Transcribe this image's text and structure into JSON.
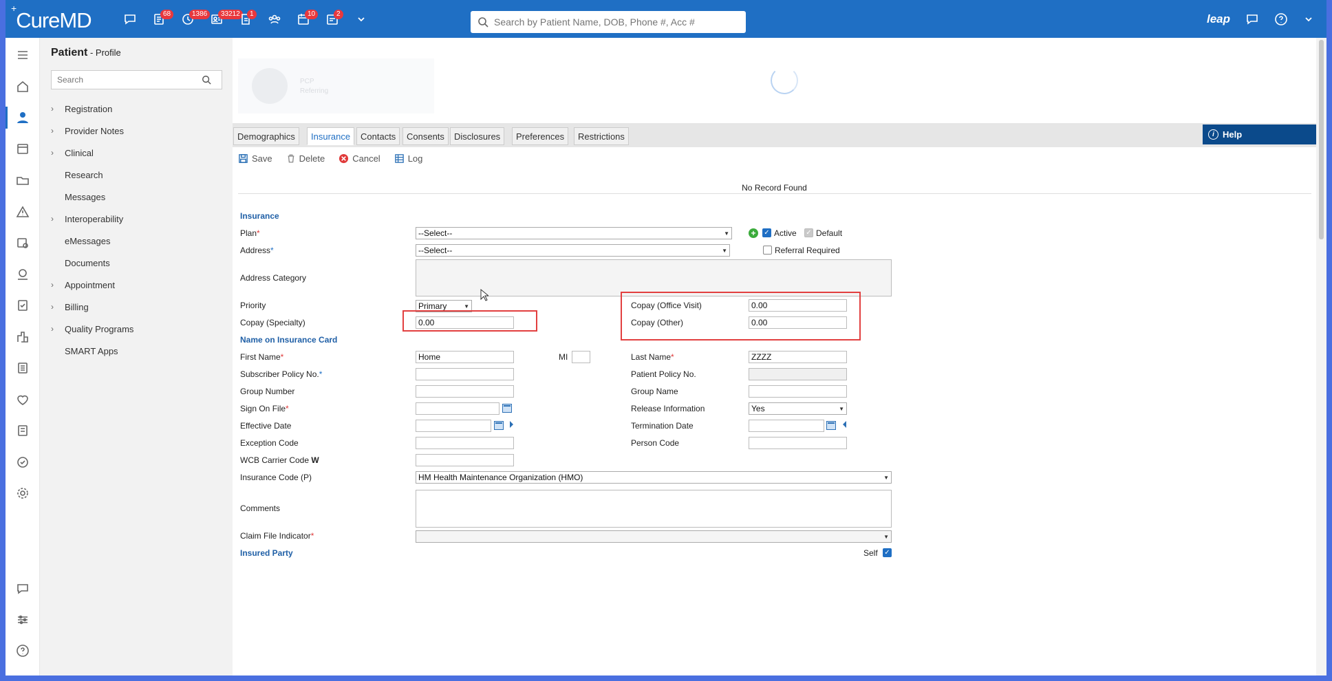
{
  "app": {
    "logo": "CureMD"
  },
  "topbar": {
    "icons": [
      {
        "name": "messages-icon",
        "badge": ""
      },
      {
        "name": "tasks-icon",
        "badge": "68"
      },
      {
        "name": "refills-icon",
        "badge": "1386"
      },
      {
        "name": "patients-icon",
        "badge": "33212"
      },
      {
        "name": "documents-icon",
        "badge": "1"
      },
      {
        "name": "groups-icon",
        "badge": ""
      },
      {
        "name": "calendar-icon",
        "badge": "10"
      },
      {
        "name": "lab-icon",
        "badge": "2"
      }
    ],
    "search_placeholder": "Search by Patient Name, DOB, Phone #, Acc #",
    "leap_label": "leap"
  },
  "leftnav": {
    "title": "Patient",
    "subtitle": " - Profile",
    "search_placeholder": "Search",
    "items": [
      {
        "label": "Registration",
        "expandable": true
      },
      {
        "label": "Provider Notes",
        "expandable": true
      },
      {
        "label": "Clinical",
        "expandable": true
      },
      {
        "label": "Research",
        "expandable": false
      },
      {
        "label": "Messages",
        "expandable": false
      },
      {
        "label": "Interoperability",
        "expandable": true
      },
      {
        "label": "eMessages",
        "expandable": false
      },
      {
        "label": "Documents",
        "expandable": false
      },
      {
        "label": "Appointment",
        "expandable": true
      },
      {
        "label": "Billing",
        "expandable": true
      },
      {
        "label": "Quality Programs",
        "expandable": true
      },
      {
        "label": "SMART Apps",
        "expandable": false
      }
    ]
  },
  "header_ghost": {
    "pcp": "PCP",
    "referring": "Referring"
  },
  "tabs": [
    "Demographics",
    "Insurance",
    "Contacts",
    "Consents",
    "Disclosures",
    "Preferences",
    "Restrictions"
  ],
  "active_tab": "Insurance",
  "help_label": "Help",
  "toolbar": {
    "save": "Save",
    "delete": "Delete",
    "cancel": "Cancel",
    "log": "Log"
  },
  "no_record": "No Record Found",
  "form": {
    "insurance_section": "Insurance",
    "plan_label": "Plan",
    "plan_value": "--Select--",
    "active_label": "Active",
    "default_label": "Default",
    "address_label": "Address",
    "address_value": "--Select--",
    "referral_label": "Referral Required",
    "address_category_label": "Address Category",
    "priority_label": "Priority",
    "priority_value": "Primary",
    "copay_office_label": "Copay (Office Visit)",
    "copay_office_value": "0.00",
    "copay_specialty_label": "Copay (Specialty)",
    "copay_specialty_value": "0.00",
    "copay_other_label": "Copay (Other)",
    "copay_other_value": "0.00",
    "name_section": "Name on Insurance Card",
    "first_name_label": "First Name",
    "first_name_value": "Home",
    "mi_label": "MI",
    "last_name_label": "Last Name",
    "last_name_value": "ZZZZ",
    "subscriber_policy_label": "Subscriber Policy No.",
    "patient_policy_label": "Patient Policy No.",
    "group_number_label": "Group Number",
    "group_name_label": "Group Name",
    "sign_on_file_label": "Sign On File",
    "release_info_label": "Release Information",
    "release_info_value": "Yes",
    "effective_date_label": "Effective Date",
    "termination_date_label": "Termination Date",
    "exception_code_label": "Exception Code",
    "person_code_label": "Person Code",
    "wcb_label": "WCB Carrier Code",
    "wcb_bold": "W",
    "insurance_code_label": "Insurance Code (P)",
    "insurance_code_value": "HM Health Maintenance Organization (HMO)",
    "comments_label": "Comments",
    "claim_file_label": "Claim File Indicator",
    "insured_party_section": "Insured Party",
    "self_label": "Self"
  },
  "colors": {
    "brand": "#1f6fc4",
    "highlight": "#e23f3f",
    "help": "#0b4a8b"
  }
}
